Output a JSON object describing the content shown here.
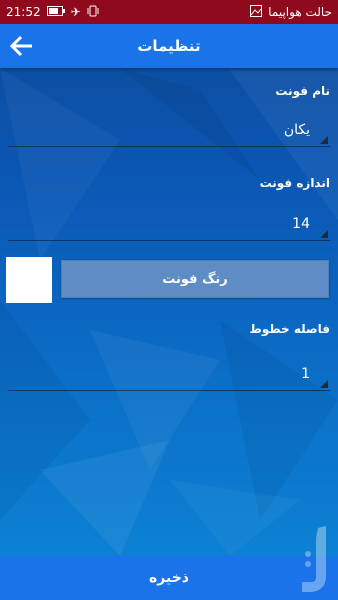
{
  "status": {
    "carrier": "حالت هواپیما",
    "time": "21:52"
  },
  "app_bar": {
    "title": "تنظیمات"
  },
  "font_name": {
    "label": "نام فونت",
    "value": "یکان"
  },
  "font_size": {
    "label": "اندازه فونت",
    "value": "14"
  },
  "font_color": {
    "button_label": "رنگ فونت",
    "swatch_color": "#ffffff"
  },
  "line_spacing": {
    "label": "فاصله خطوط",
    "value": "1"
  },
  "footer": {
    "save_label": "ذخیره"
  },
  "colors": {
    "status_bar": "#8f0a1c",
    "app_bar": "#1a73e8",
    "button": "#5d8dc4"
  }
}
